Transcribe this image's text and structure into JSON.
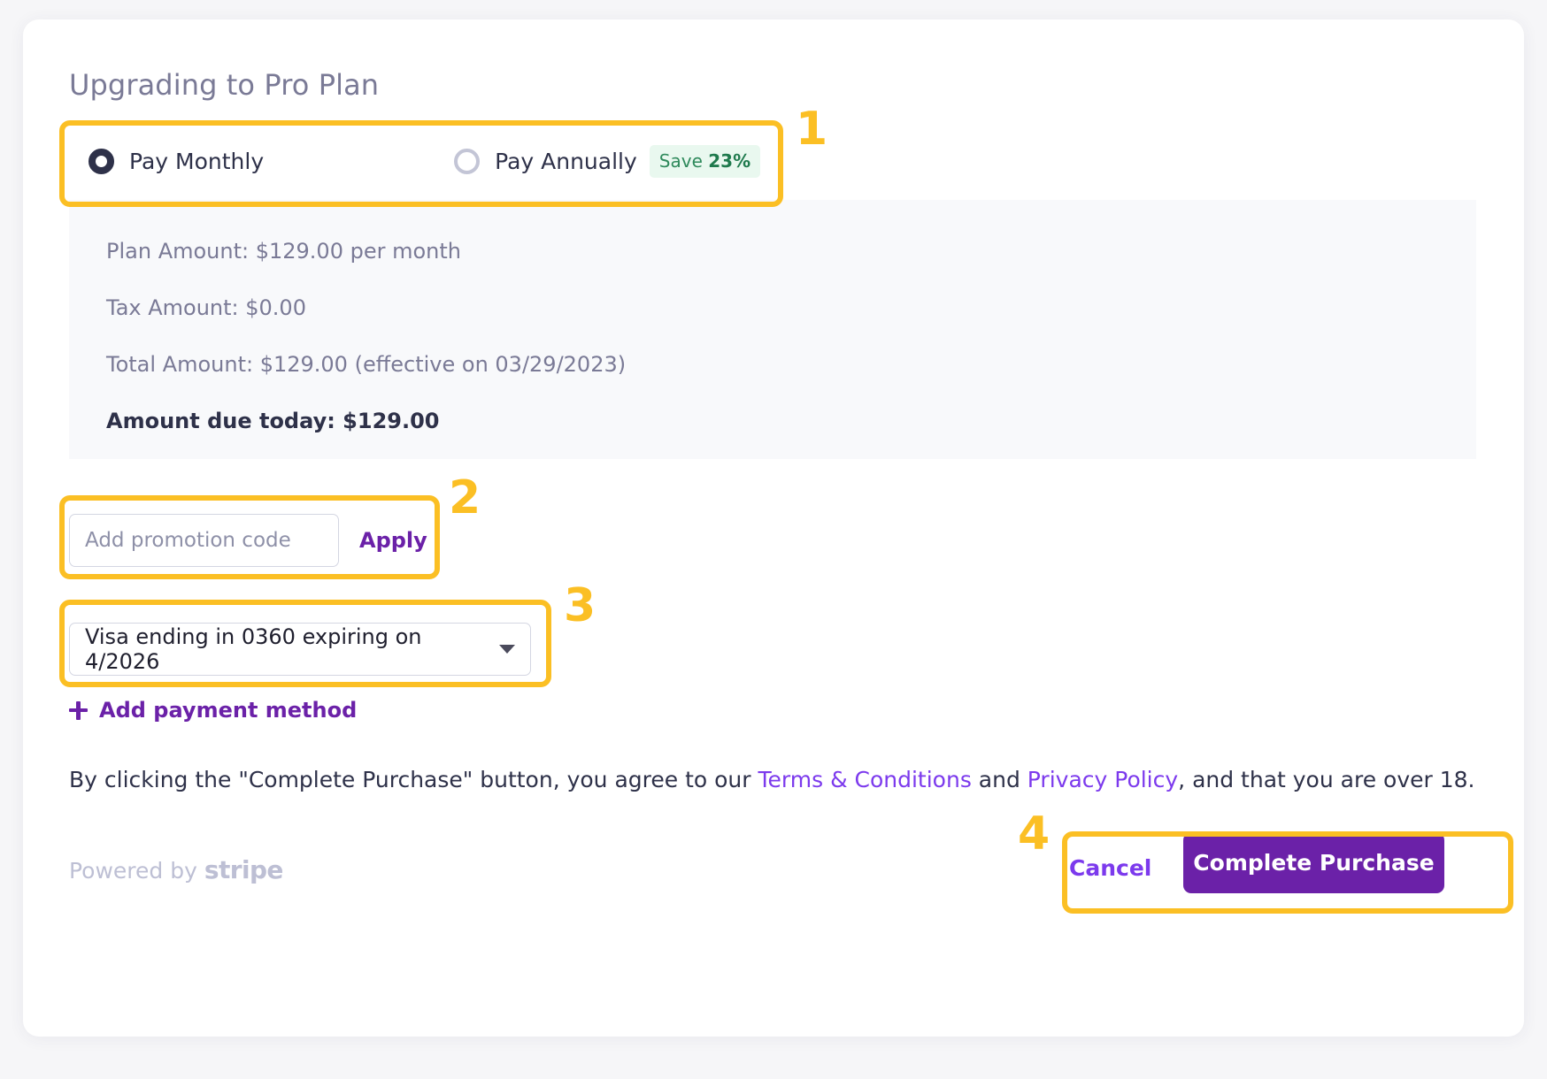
{
  "page": {
    "title": "Upgrading to Pro Plan"
  },
  "billing_cycle": {
    "monthly_label": "Pay Monthly",
    "monthly_selected": true,
    "annual_label": "Pay Annually",
    "annual_selected": false,
    "save_badge_prefix": "Save ",
    "save_badge_value": "23%"
  },
  "summary": {
    "plan_amount": "Plan Amount: $129.00 per month",
    "tax_amount": "Tax Amount: $0.00",
    "total_amount": "Total Amount: $129.00 (effective on 03/29/2023)",
    "amount_due_today": "Amount due today: $129.00"
  },
  "promotion": {
    "placeholder": "Add promotion code",
    "value": "",
    "apply_label": "Apply"
  },
  "payment_method": {
    "selected": "Visa ending in 0360 expiring on 4/2026",
    "add_label": "Add payment method"
  },
  "terms": {
    "before": "By clicking the \"Complete Purchase\" button, you agree to our ",
    "terms_link": "Terms & Conditions",
    "between": " and ",
    "privacy_link": "Privacy Policy",
    "after": ", and that you are over 18."
  },
  "footer": {
    "powered_by": "Powered by",
    "stripe": "stripe",
    "cancel_label": "Cancel",
    "complete_label": "Complete Purchase"
  },
  "annotations": {
    "one": "1",
    "two": "2",
    "three": "3",
    "four": "4"
  },
  "colors": {
    "accent_purple": "#6b21a8",
    "link_purple": "#7c3aed",
    "annotation_yellow": "#fbbf24",
    "save_green": "#2f8a5c",
    "text_dark": "#2e3149",
    "text_muted": "#7a7a96"
  }
}
